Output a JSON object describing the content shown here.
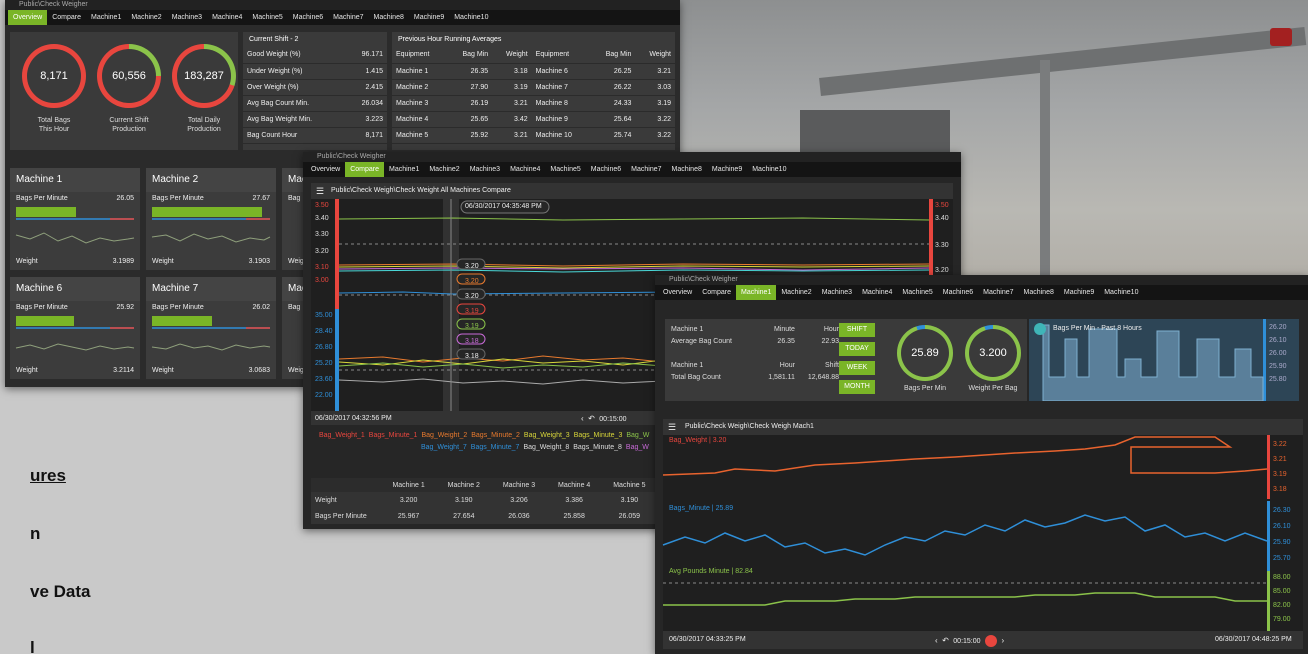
{
  "slide": {
    "lines": [
      "ures",
      "n",
      "ve Data",
      "l"
    ]
  },
  "win1": {
    "title": "Public\\Check Weigher",
    "tabs": [
      "Overview",
      "Compare",
      "Machine1",
      "Machine2",
      "Machine3",
      "Machine4",
      "Machine5",
      "Machine6",
      "Machine7",
      "Machine8",
      "Machine9",
      "Machine10"
    ],
    "gauges": [
      {
        "value": "8,171",
        "label1": "Total Bags",
        "label2": "This Hour"
      },
      {
        "value": "60,556",
        "label1": "Current Shift",
        "label2": "Production"
      },
      {
        "value": "183,287",
        "label1": "Total Daily",
        "label2": "Production"
      }
    ],
    "shift": {
      "title": "Current Shift -  2",
      "rows": [
        [
          "Good Weight (%)",
          "96.171"
        ],
        [
          "Under Weight (%)",
          "1.415"
        ],
        [
          "Over Weight (%)",
          "2.415"
        ],
        [
          "Avg Bag Count Min.",
          "26.034"
        ],
        [
          "Avg Bag Weight Min.",
          "3.223"
        ],
        [
          "Bag Count Hour",
          "8,171"
        ]
      ]
    },
    "prev": {
      "title": "Previous Hour Running Averages",
      "headers": [
        "Equipment",
        "Bag Min",
        "Weight",
        "Equipment",
        "Bag Min",
        "Weight"
      ],
      "rows": [
        [
          "Machine 1",
          "26.35",
          "3.18",
          "Machine 6",
          "26.25",
          "3.21"
        ],
        [
          "Machine 2",
          "27.90",
          "3.19",
          "Machine 7",
          "26.22",
          "3.03"
        ],
        [
          "Machine 3",
          "26.19",
          "3.21",
          "Machine 8",
          "24.33",
          "3.19"
        ],
        [
          "Machine 4",
          "25.65",
          "3.42",
          "Machine 9",
          "25.64",
          "3.22"
        ],
        [
          "Machine 5",
          "25.92",
          "3.21",
          "Machine 10",
          "25.74",
          "3.22"
        ]
      ]
    },
    "cards": [
      {
        "name": "Machine 1",
        "bpm_label": "Bags Per Minute",
        "bpm": "26.05",
        "w_label": "Weight",
        "weight": "3.1989"
      },
      {
        "name": "Machine 2",
        "bpm_label": "Bags Per Minute",
        "bpm": "27.67",
        "w_label": "Weight",
        "weight": "3.1903"
      },
      {
        "name": "Mac",
        "bpm_label": "Bag",
        "bpm": "",
        "w_label": "Weig",
        "weight": ""
      },
      {
        "name": "Machine 6",
        "bpm_label": "Bags Per Minute",
        "bpm": "25.92",
        "w_label": "Weight",
        "weight": "3.2114"
      },
      {
        "name": "Machine 7",
        "bpm_label": "Bags Per Minute",
        "bpm": "26.02",
        "w_label": "Weight",
        "weight": "3.0683"
      },
      {
        "name": "Mac",
        "bpm_label": "Bag",
        "bpm": "",
        "w_label": "Weig",
        "weight": ""
      }
    ],
    "colors": {
      "accent": "#7ab527",
      "ring_green": "#8bc34a",
      "ring_red": "#e8463e"
    }
  },
  "win2": {
    "title": "Public\\Check Weigher",
    "tabs": [
      "Overview",
      "Compare",
      "Machine1",
      "Machine2",
      "Machine3",
      "Machine4",
      "Machine5",
      "Machine6",
      "Machine7",
      "Machine8",
      "Machine9",
      "Machine10"
    ],
    "chart_title": "Public\\Check Weigh\\Check Weight All Machines Compare",
    "cursor_time": "06/30/2017 04:35:48 PM",
    "left_ticks": [
      "3.50",
      "3.40",
      "3.30",
      "3.20",
      "3.10",
      "3.00",
      "35.00",
      "28.40",
      "26.80",
      "25.20",
      "23.60",
      "22.00"
    ],
    "right_ticks": [
      "3.50",
      "3.40",
      "3.30",
      "3.20"
    ],
    "cursor_values": [
      "3.20",
      "3.20",
      "3.20",
      "3.19",
      "3.19",
      "3.18",
      "3.18"
    ],
    "footer_time": "06/30/2017 04:32:56 PM",
    "window": "00:15:00",
    "legend1": [
      "Bag_Weight_1",
      "Bags_Minute_1",
      "Bag_Weight_2",
      "Bags_Minute_2",
      "Bag_Weight_3",
      "Bags_Minute_3",
      "Bag_W"
    ],
    "legend2": [
      "Bag_Weight_7",
      "Bags_Minute_7",
      "Bag_Weight_8",
      "Bags_Minute_8",
      "Bag_W"
    ],
    "table": {
      "headers": [
        "",
        "Machine 1",
        "Machine 2",
        "Machine 3",
        "Machine 4",
        "Machine 5"
      ],
      "rows": [
        [
          "Weight",
          "3.200",
          "3.190",
          "3.206",
          "3.386",
          "3.190"
        ],
        [
          "Bags Per Minute",
          "25.967",
          "27.654",
          "26.036",
          "25.858",
          "26.059"
        ]
      ]
    }
  },
  "win3": {
    "title": "Public\\Check Weigher",
    "tabs": [
      "Overview",
      "Compare",
      "Machine1",
      "Machine2",
      "Machine3",
      "Machine4",
      "Machine5",
      "Machine6",
      "Machine7",
      "Machine8",
      "Machine9",
      "Machine10"
    ],
    "stats": {
      "h1": [
        "Machine 1",
        "Minute",
        "Hour"
      ],
      "r1": [
        "Average Bag Count",
        "26.35",
        "22.93"
      ],
      "h2": [
        "Machine 1",
        "Hour",
        "Shift"
      ],
      "r2": [
        "Total Bag Count",
        "1,581.11",
        "12,648.88"
      ]
    },
    "buttons": [
      "SHIFT",
      "TODAY",
      "WEEK",
      "MONTH"
    ],
    "g1": {
      "value": "25.89",
      "label": "Bags Per Min"
    },
    "g2": {
      "value": "3.200",
      "label": "Weight Per Bag"
    },
    "mini": {
      "title": "Bags Per Min - Past 8 Hours",
      "ticks": [
        "26.20",
        "26.10",
        "26.00",
        "25.90",
        "25.80"
      ]
    },
    "chart_title": "Public\\Check Weigh\\Check Weigh Mach1",
    "s1": "Bag_Weight | 3.20",
    "s2": "Bags_Minute | 25.89",
    "s3": "Avg Pounds Minute | 82.84",
    "r_red": [
      "3.22",
      "3.21",
      "3.19",
      "3.18"
    ],
    "r_blue": [
      "26.30",
      "26.10",
      "25.90",
      "25.70"
    ],
    "r_green": [
      "88.00",
      "85.00",
      "82.00",
      "79.00"
    ],
    "start": "06/30/2017 04:33:25 PM",
    "end": "06/30/2017 04:48:25 PM",
    "window": "00:15:00"
  }
}
